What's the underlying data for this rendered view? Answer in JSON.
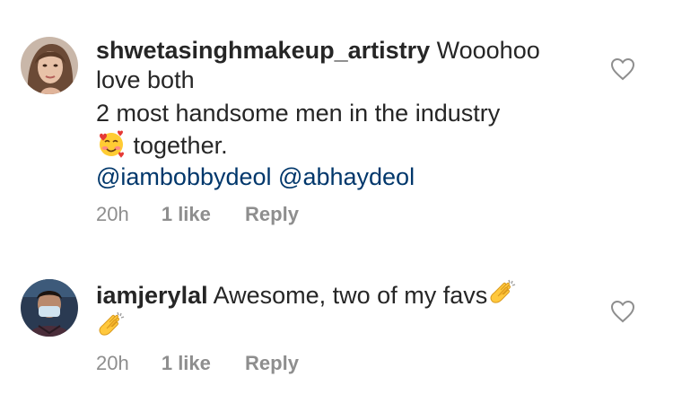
{
  "comments": [
    {
      "username": "shwetasinghmakeup_artistry",
      "text_line1": " Wooohoo",
      "text_line2": "love both",
      "text_line3": "2 most handsome men in the industry",
      "text_line4": " together.",
      "line4_emoji": "smiling-face-with-hearts-icon",
      "mentions": [
        "@iambobbydeol",
        "@abhaydeol"
      ],
      "time": "20h",
      "likes": "1 like",
      "reply_label": "Reply"
    },
    {
      "username": "iamjerylal",
      "text": " Awesome, two of my favs",
      "trailing_emoji": "clapping-hands-icon",
      "time": "20h",
      "likes": "1 like",
      "reply_label": "Reply"
    }
  ],
  "colors": {
    "text": "#262626",
    "meta": "#8e8e8e",
    "mention": "#00376b",
    "background": "#ffffff"
  }
}
